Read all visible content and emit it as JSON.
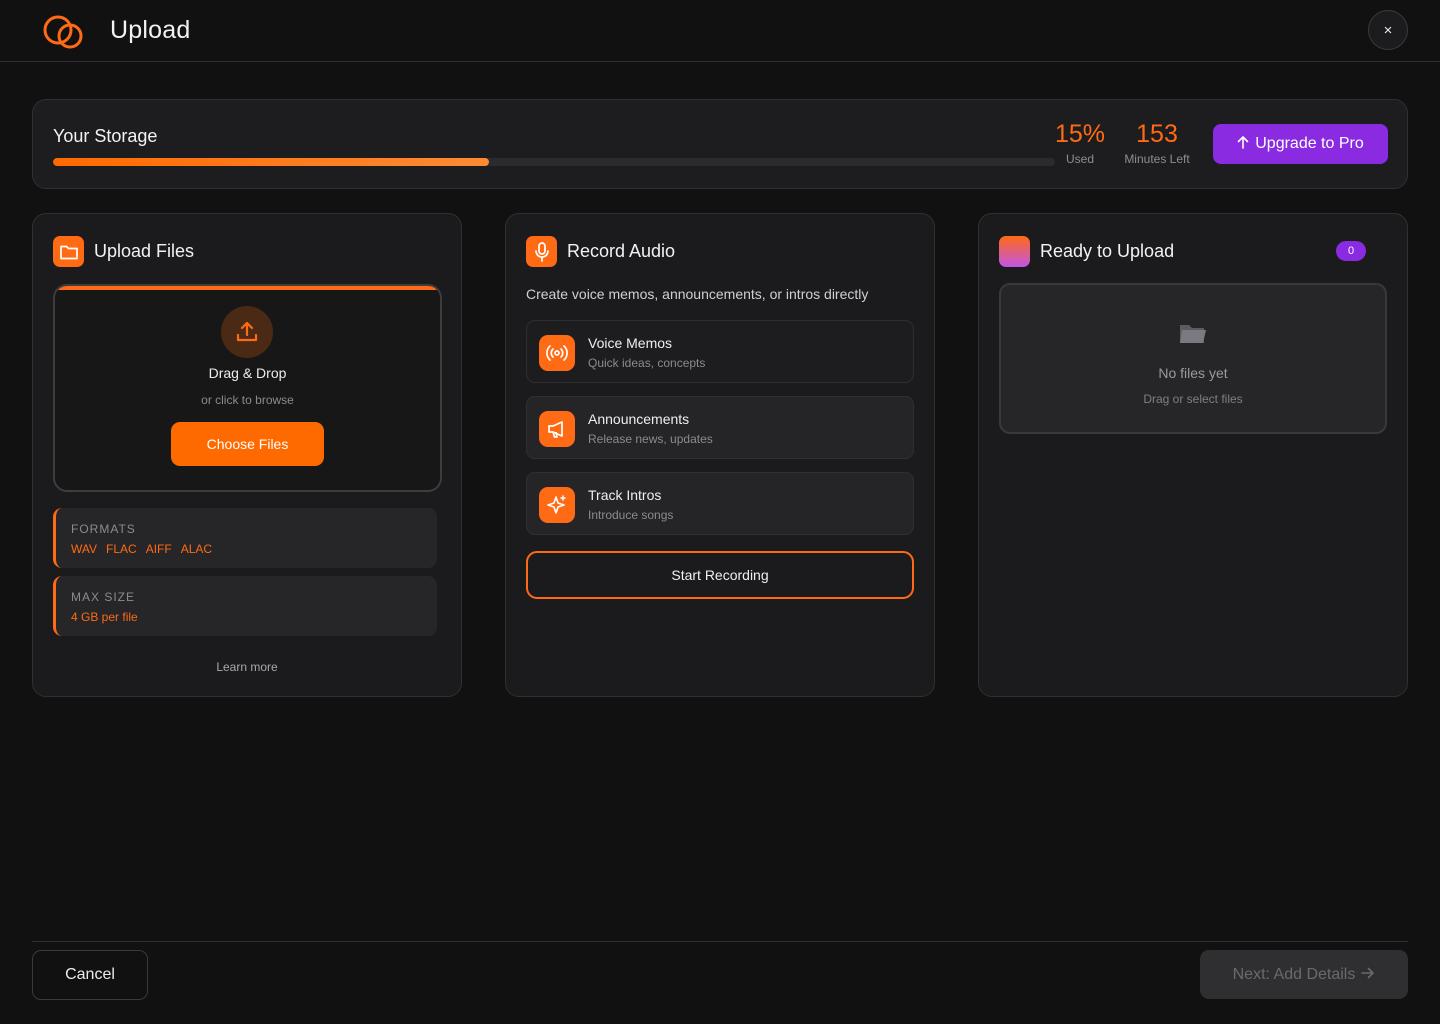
{
  "header": {
    "title": "Upload",
    "logo_icon": "linked-rings-logo",
    "close_label": "×"
  },
  "storage": {
    "title": "Your Storage",
    "used_fraction": 0.435,
    "used_value": "15%",
    "used_label": "Used",
    "minutes_value": "153",
    "minutes_label": "Minutes Left",
    "upgrade_label": "Upgrade to Pro",
    "upgrade_icon": "arrow-up-icon"
  },
  "upload_files": {
    "title": "Upload Files",
    "icon": "folder-icon",
    "dropzone_title": "Drag & Drop",
    "dropzone_sub": "or click to browse",
    "choose_label": "Choose Files",
    "formats_label": "FORMATS",
    "formats": [
      "WAV",
      "FLAC",
      "AIFF",
      "ALAC"
    ],
    "max_size_label": "MAX SIZE",
    "max_size_value": "4 GB per file",
    "learn_more": "Learn more"
  },
  "record_audio": {
    "title": "Record Audio",
    "icon": "microphone-icon",
    "description": "Create voice memos, announcements, or intros directly",
    "options": [
      {
        "title": "Voice Memos",
        "subtitle": "Quick ideas, concepts",
        "icon": "broadcast-icon"
      },
      {
        "title": "Announcements",
        "subtitle": "Release news, updates",
        "icon": "megaphone-icon"
      },
      {
        "title": "Track Intros",
        "subtitle": "Introduce songs",
        "icon": "sparkles-icon"
      }
    ],
    "start_label": "Start Recording"
  },
  "ready": {
    "title": "Ready to Upload",
    "count": "0",
    "empty_title": "No files yet",
    "empty_sub": "Drag or select files"
  },
  "footer": {
    "cancel_label": "Cancel",
    "next_label": "Next: Add Details",
    "next_icon": "arrow-right-icon"
  },
  "colors": {
    "background": "#111112",
    "accent": "#ff6a14",
    "purple": "#8a2be2"
  }
}
